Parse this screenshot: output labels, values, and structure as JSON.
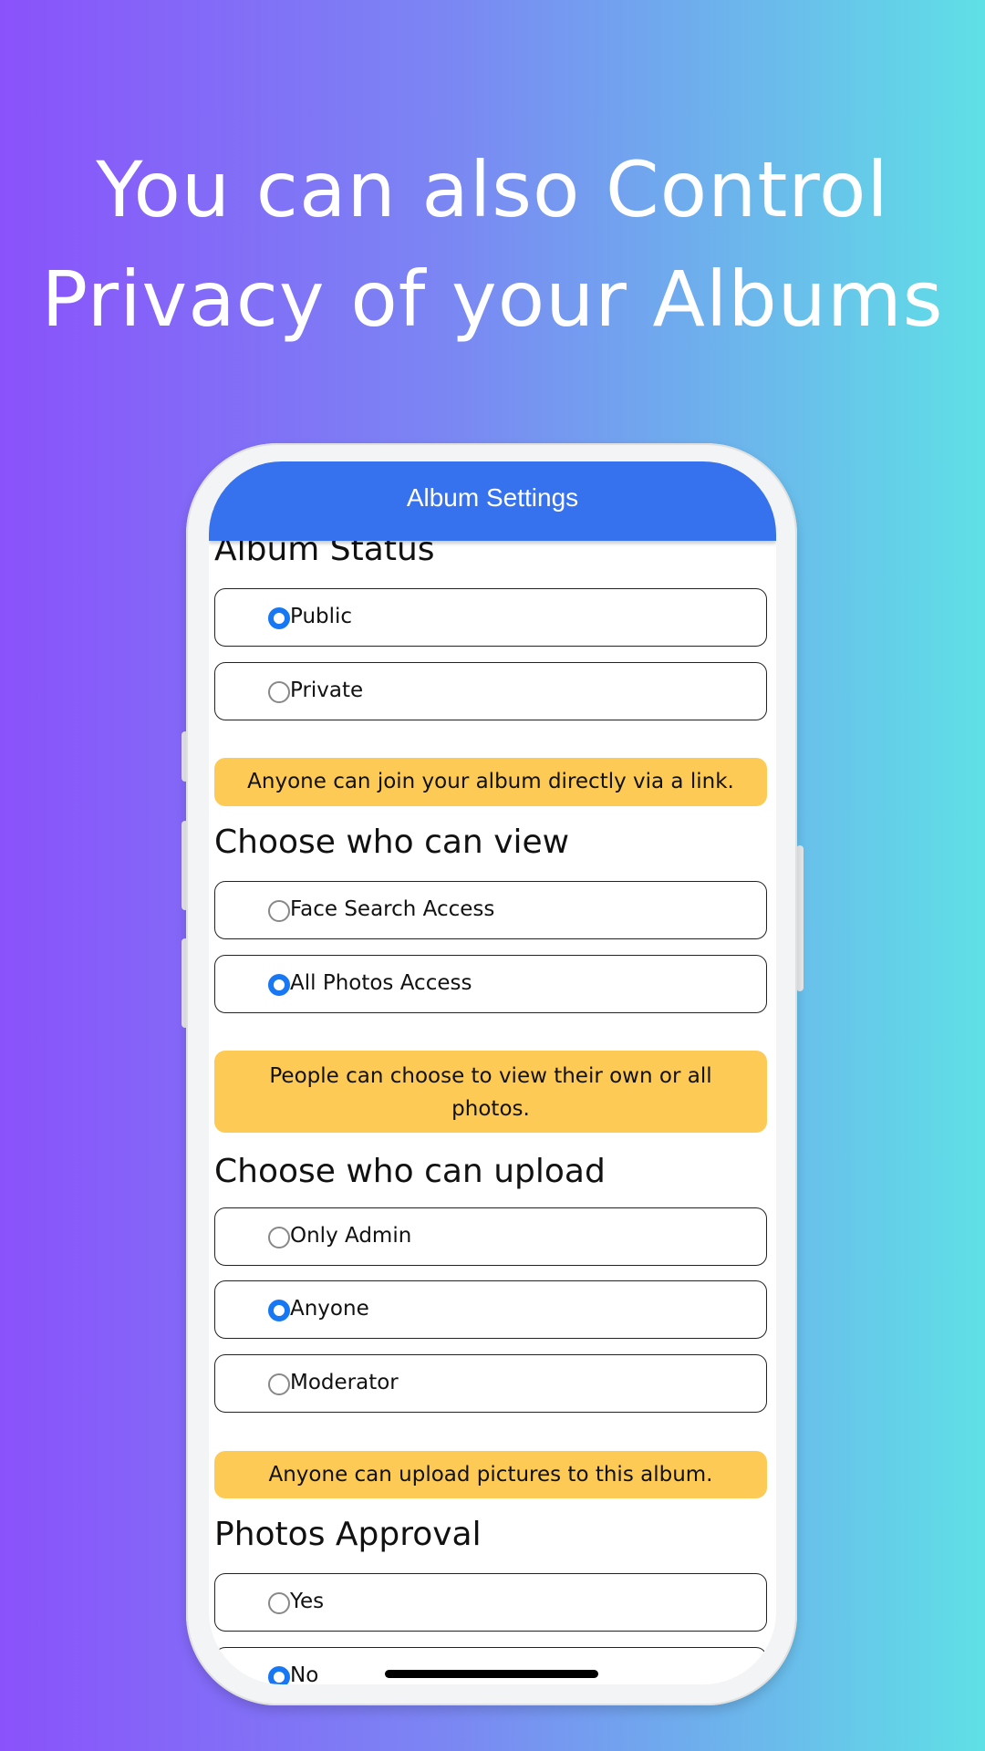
{
  "headline": {
    "line1": "You can also Control",
    "line2": "Privacy of your Albums"
  },
  "appbar": {
    "title": "Album Settings",
    "back_icon": "chevron-left-icon"
  },
  "sections": [
    {
      "title": "Album Status",
      "options": [
        {
          "label": "Public",
          "selected": true
        },
        {
          "label": "Private",
          "selected": false
        }
      ],
      "info": "Anyone can join your album directly via a link."
    },
    {
      "title": "Choose who can view",
      "options": [
        {
          "label": "Face Search Access",
          "selected": false
        },
        {
          "label": "All Photos Access",
          "selected": true
        }
      ],
      "info": "People can choose to view their own or all photos."
    },
    {
      "title": "Choose who can upload",
      "options": [
        {
          "label": "Only Admin",
          "selected": false
        },
        {
          "label": "Anyone",
          "selected": true
        },
        {
          "label": "Moderator",
          "selected": false
        }
      ],
      "info": "Anyone can upload pictures to this album."
    },
    {
      "title": "Photos Approval",
      "options": [
        {
          "label": "Yes",
          "selected": false
        },
        {
          "label": "No",
          "selected": true
        }
      ]
    }
  ],
  "colors": {
    "appbar": "#3772ee",
    "radio_selected": "#1877f2",
    "info_bg": "#fdca55"
  }
}
